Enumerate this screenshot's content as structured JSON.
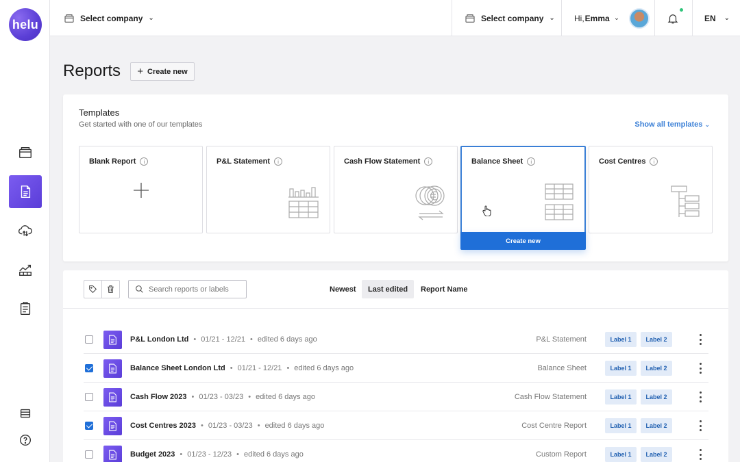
{
  "app": {
    "logo_text": "helu"
  },
  "topbar": {
    "company_select_1": "Select company",
    "company_select_2": "Select company",
    "greeting": "Hi,",
    "user_name": "Emma",
    "language": "EN"
  },
  "header": {
    "title": "Reports",
    "create_label": "Create new"
  },
  "templates": {
    "title": "Templates",
    "subtitle": "Get started with one of our templates",
    "show_all": "Show all templates",
    "cards": [
      {
        "name": "Blank Report"
      },
      {
        "name": "P&L Statement"
      },
      {
        "name": "Cash Flow Statement"
      },
      {
        "name": "Balance Sheet"
      },
      {
        "name": "Cost Centres"
      }
    ],
    "create_button": "Create new"
  },
  "list": {
    "search_placeholder": "Search reports or labels",
    "sort_options": [
      "Newest",
      "Last edited",
      "Report Name"
    ],
    "active_sort": "Last edited",
    "rows": [
      {
        "name": "P&L London Ltd",
        "period": "01/21 - 12/21",
        "edited": "edited 6 days ago",
        "type": "P&L Statement",
        "checked": false,
        "label1": "Label 1",
        "label2": "Label 2"
      },
      {
        "name": "Balance Sheet London Ltd",
        "period": "01/21 - 12/21",
        "edited": "edited 6 days ago",
        "type": "Balance Sheet",
        "checked": true,
        "label1": "Label 1",
        "label2": "Label 2"
      },
      {
        "name": "Cash Flow 2023",
        "period": "01/23 - 03/23",
        "edited": "edited 6 days ago",
        "type": "Cash Flow Statement",
        "checked": false,
        "label1": "Label 1",
        "label2": "Label 2"
      },
      {
        "name": "Cost Centres 2023",
        "period": "01/23 - 03/23",
        "edited": "edited 6 days ago",
        "type": "Cost Centre Report",
        "checked": true,
        "label1": "Label 1",
        "label2": "Label 2"
      },
      {
        "name": "Budget 2023",
        "period": "01/23 - 12/23",
        "edited": "edited 6 days ago",
        "type": "Custom Report",
        "checked": false,
        "label1": "Label 1",
        "label2": "Label 2"
      }
    ]
  },
  "colors": {
    "accent": "#1f6fd8",
    "brand": "#5b3fd6",
    "label_bg": "#e2ebf8"
  }
}
